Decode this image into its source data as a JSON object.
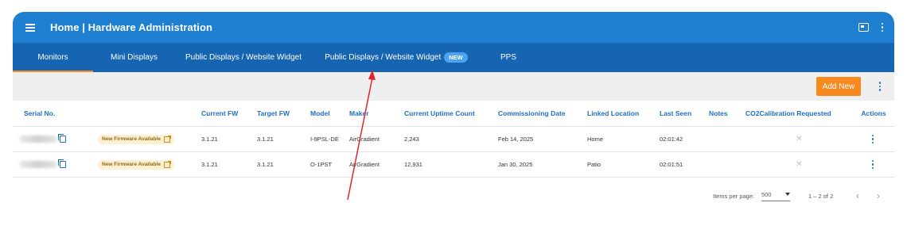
{
  "header": {
    "title": "Home | Hardware Administration",
    "menu_icon": "hamburger-menu-icon",
    "display_icon": "display-icon",
    "more_icon": "more-vertical-icon"
  },
  "tabs": [
    {
      "label": "Monitors",
      "active": true
    },
    {
      "label": "Mini Displays",
      "active": false
    },
    {
      "label": "Public Displays / Website Widget",
      "active": false
    },
    {
      "label": "Public Displays / Website Widget",
      "badge": "NEW",
      "active": false
    },
    {
      "label": "PPS",
      "active": false
    }
  ],
  "toolbar": {
    "add_label": "Add New"
  },
  "table": {
    "columns": [
      "Serial No.",
      "",
      "Current FW",
      "Target FW",
      "Model",
      "Maker",
      "Current Uptime Count",
      "Commissioning Date",
      "Linked Location",
      "Last Seen",
      "Notes",
      "CO2Calibration Requested",
      "Actions"
    ],
    "rows": [
      {
        "firmware_badge": "New Firmware Available",
        "current_fw": "3.1.21",
        "target_fw": "3.1.21",
        "model": "I-9PSL-DE",
        "maker": "AirGradient",
        "uptime": "2,243",
        "commissioning": "Feb 14, 2025",
        "location": "Home",
        "last_seen": "02:01:42",
        "notes": "",
        "calibration": "✕"
      },
      {
        "firmware_badge": "New Firmware Available",
        "current_fw": "3.1.21",
        "target_fw": "3.1.21",
        "model": "O-1PST",
        "maker": "AirGradient",
        "uptime": "12,931",
        "commissioning": "Jan 30, 2025",
        "location": "Patio",
        "last_seen": "02:01:51",
        "notes": "",
        "calibration": "✕"
      }
    ]
  },
  "pagination": {
    "items_per_page_label": "Items per page:",
    "items_per_page_value": "500",
    "range": "1 – 2 of 2",
    "prev": "‹",
    "next": "›"
  },
  "colors": {
    "header": "#1f7fd0",
    "tabs": "#1665b3",
    "accent": "#f7891f",
    "link": "#1f6fc0"
  }
}
